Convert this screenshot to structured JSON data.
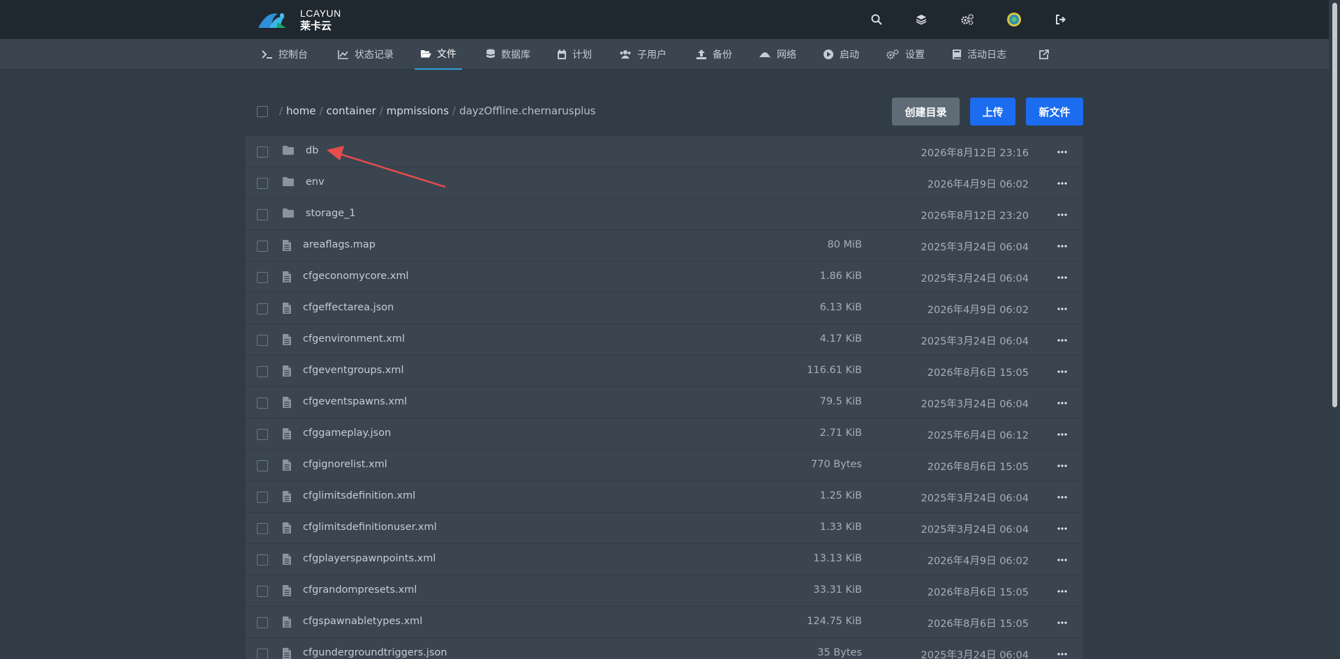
{
  "brand": {
    "name": "LCAYUN",
    "subtitle": "莱卡云"
  },
  "top_icons": [
    "search-icon",
    "layers-icon",
    "cogs-icon",
    "avatar",
    "logout-icon"
  ],
  "nav": [
    {
      "label": "控制台",
      "icon": "terminal-icon"
    },
    {
      "label": "状态记录",
      "icon": "chart-line-icon"
    },
    {
      "label": "文件",
      "icon": "folder-open-icon",
      "active": true
    },
    {
      "label": "数据库",
      "icon": "database-icon"
    },
    {
      "label": "计划",
      "icon": "calendar-icon"
    },
    {
      "label": "子用户",
      "icon": "users-icon"
    },
    {
      "label": "备份",
      "icon": "upload-icon"
    },
    {
      "label": "网络",
      "icon": "network-icon"
    },
    {
      "label": "启动",
      "icon": "play-circle-icon"
    },
    {
      "label": "设置",
      "icon": "cogs-icon"
    },
    {
      "label": "活动日志",
      "icon": "book-icon"
    },
    {
      "label": "",
      "icon": "external-link-icon"
    }
  ],
  "breadcrumb": {
    "root": "/",
    "segments": [
      "home",
      "container",
      "mpmissions"
    ],
    "current": "dayzOffline.chernarusplus"
  },
  "buttons": {
    "create_dir": "创建目录",
    "upload": "上传",
    "new_file": "新文件"
  },
  "files": [
    {
      "name": "db",
      "type": "folder",
      "size": "",
      "date": "2026年8月12日 23:16"
    },
    {
      "name": "env",
      "type": "folder",
      "size": "",
      "date": "2026年4月9日 06:02"
    },
    {
      "name": "storage_1",
      "type": "folder",
      "size": "",
      "date": "2026年8月12日 23:20"
    },
    {
      "name": "areaflags.map",
      "type": "file",
      "size": "80 MiB",
      "date": "2025年3月24日 06:04"
    },
    {
      "name": "cfgeconomycore.xml",
      "type": "file",
      "size": "1.86 KiB",
      "date": "2025年3月24日 06:04"
    },
    {
      "name": "cfgeffectarea.json",
      "type": "file",
      "size": "6.13 KiB",
      "date": "2026年4月9日 06:02"
    },
    {
      "name": "cfgenvironment.xml",
      "type": "file",
      "size": "4.17 KiB",
      "date": "2025年3月24日 06:04"
    },
    {
      "name": "cfgeventgroups.xml",
      "type": "file",
      "size": "116.61 KiB",
      "date": "2026年8月6日 15:05"
    },
    {
      "name": "cfgeventspawns.xml",
      "type": "file",
      "size": "79.5 KiB",
      "date": "2025年3月24日 06:04"
    },
    {
      "name": "cfggameplay.json",
      "type": "file",
      "size": "2.71 KiB",
      "date": "2025年6月4日 06:12"
    },
    {
      "name": "cfgignorelist.xml",
      "type": "file",
      "size": "770 Bytes",
      "date": "2026年8月6日 15:05"
    },
    {
      "name": "cfglimitsdefinition.xml",
      "type": "file",
      "size": "1.25 KiB",
      "date": "2025年3月24日 06:04"
    },
    {
      "name": "cfglimitsdefinitionuser.xml",
      "type": "file",
      "size": "1.33 KiB",
      "date": "2025年3月24日 06:04"
    },
    {
      "name": "cfgplayerspawnpoints.xml",
      "type": "file",
      "size": "13.13 KiB",
      "date": "2026年4月9日 06:02"
    },
    {
      "name": "cfgrandompresets.xml",
      "type": "file",
      "size": "33.31 KiB",
      "date": "2026年8月6日 15:05"
    },
    {
      "name": "cfgspawnabletypes.xml",
      "type": "file",
      "size": "124.75 KiB",
      "date": "2026年8月6日 15:05"
    },
    {
      "name": "cfgundergroundtriggers.json",
      "type": "file",
      "size": "35 Bytes",
      "date": "2025年3月24日 06:04"
    }
  ],
  "colors": {
    "accent": "#1c6cf0",
    "active_tab_underline": "#2fa0d8",
    "annotation_arrow": "#e84c4c"
  }
}
